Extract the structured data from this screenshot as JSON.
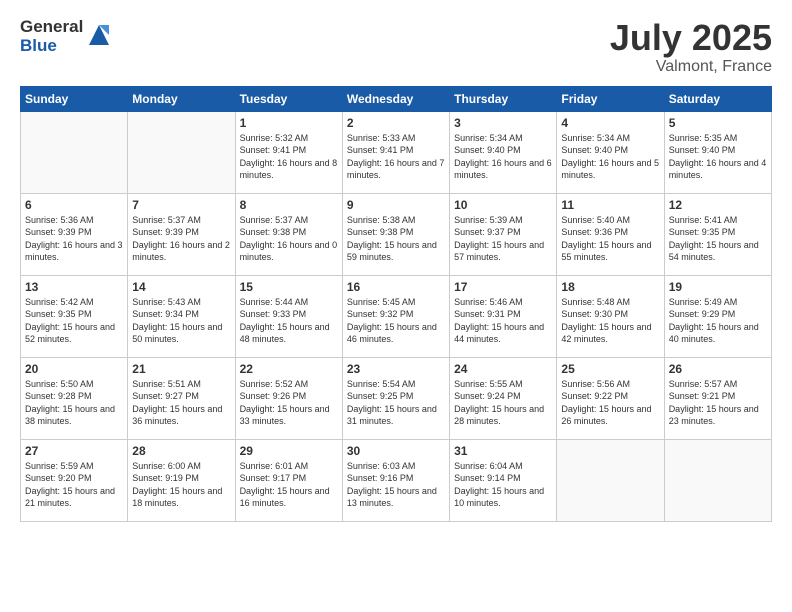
{
  "logo": {
    "general": "General",
    "blue": "Blue"
  },
  "title": "July 2025",
  "location": "Valmont, France",
  "days_of_week": [
    "Sunday",
    "Monday",
    "Tuesday",
    "Wednesday",
    "Thursday",
    "Friday",
    "Saturday"
  ],
  "weeks": [
    [
      {
        "day": "",
        "info": ""
      },
      {
        "day": "",
        "info": ""
      },
      {
        "day": "1",
        "info": "Sunrise: 5:32 AM\nSunset: 9:41 PM\nDaylight: 16 hours and 8 minutes."
      },
      {
        "day": "2",
        "info": "Sunrise: 5:33 AM\nSunset: 9:41 PM\nDaylight: 16 hours and 7 minutes."
      },
      {
        "day": "3",
        "info": "Sunrise: 5:34 AM\nSunset: 9:40 PM\nDaylight: 16 hours and 6 minutes."
      },
      {
        "day": "4",
        "info": "Sunrise: 5:34 AM\nSunset: 9:40 PM\nDaylight: 16 hours and 5 minutes."
      },
      {
        "day": "5",
        "info": "Sunrise: 5:35 AM\nSunset: 9:40 PM\nDaylight: 16 hours and 4 minutes."
      }
    ],
    [
      {
        "day": "6",
        "info": "Sunrise: 5:36 AM\nSunset: 9:39 PM\nDaylight: 16 hours and 3 minutes."
      },
      {
        "day": "7",
        "info": "Sunrise: 5:37 AM\nSunset: 9:39 PM\nDaylight: 16 hours and 2 minutes."
      },
      {
        "day": "8",
        "info": "Sunrise: 5:37 AM\nSunset: 9:38 PM\nDaylight: 16 hours and 0 minutes."
      },
      {
        "day": "9",
        "info": "Sunrise: 5:38 AM\nSunset: 9:38 PM\nDaylight: 15 hours and 59 minutes."
      },
      {
        "day": "10",
        "info": "Sunrise: 5:39 AM\nSunset: 9:37 PM\nDaylight: 15 hours and 57 minutes."
      },
      {
        "day": "11",
        "info": "Sunrise: 5:40 AM\nSunset: 9:36 PM\nDaylight: 15 hours and 55 minutes."
      },
      {
        "day": "12",
        "info": "Sunrise: 5:41 AM\nSunset: 9:35 PM\nDaylight: 15 hours and 54 minutes."
      }
    ],
    [
      {
        "day": "13",
        "info": "Sunrise: 5:42 AM\nSunset: 9:35 PM\nDaylight: 15 hours and 52 minutes."
      },
      {
        "day": "14",
        "info": "Sunrise: 5:43 AM\nSunset: 9:34 PM\nDaylight: 15 hours and 50 minutes."
      },
      {
        "day": "15",
        "info": "Sunrise: 5:44 AM\nSunset: 9:33 PM\nDaylight: 15 hours and 48 minutes."
      },
      {
        "day": "16",
        "info": "Sunrise: 5:45 AM\nSunset: 9:32 PM\nDaylight: 15 hours and 46 minutes."
      },
      {
        "day": "17",
        "info": "Sunrise: 5:46 AM\nSunset: 9:31 PM\nDaylight: 15 hours and 44 minutes."
      },
      {
        "day": "18",
        "info": "Sunrise: 5:48 AM\nSunset: 9:30 PM\nDaylight: 15 hours and 42 minutes."
      },
      {
        "day": "19",
        "info": "Sunrise: 5:49 AM\nSunset: 9:29 PM\nDaylight: 15 hours and 40 minutes."
      }
    ],
    [
      {
        "day": "20",
        "info": "Sunrise: 5:50 AM\nSunset: 9:28 PM\nDaylight: 15 hours and 38 minutes."
      },
      {
        "day": "21",
        "info": "Sunrise: 5:51 AM\nSunset: 9:27 PM\nDaylight: 15 hours and 36 minutes."
      },
      {
        "day": "22",
        "info": "Sunrise: 5:52 AM\nSunset: 9:26 PM\nDaylight: 15 hours and 33 minutes."
      },
      {
        "day": "23",
        "info": "Sunrise: 5:54 AM\nSunset: 9:25 PM\nDaylight: 15 hours and 31 minutes."
      },
      {
        "day": "24",
        "info": "Sunrise: 5:55 AM\nSunset: 9:24 PM\nDaylight: 15 hours and 28 minutes."
      },
      {
        "day": "25",
        "info": "Sunrise: 5:56 AM\nSunset: 9:22 PM\nDaylight: 15 hours and 26 minutes."
      },
      {
        "day": "26",
        "info": "Sunrise: 5:57 AM\nSunset: 9:21 PM\nDaylight: 15 hours and 23 minutes."
      }
    ],
    [
      {
        "day": "27",
        "info": "Sunrise: 5:59 AM\nSunset: 9:20 PM\nDaylight: 15 hours and 21 minutes."
      },
      {
        "day": "28",
        "info": "Sunrise: 6:00 AM\nSunset: 9:19 PM\nDaylight: 15 hours and 18 minutes."
      },
      {
        "day": "29",
        "info": "Sunrise: 6:01 AM\nSunset: 9:17 PM\nDaylight: 15 hours and 16 minutes."
      },
      {
        "day": "30",
        "info": "Sunrise: 6:03 AM\nSunset: 9:16 PM\nDaylight: 15 hours and 13 minutes."
      },
      {
        "day": "31",
        "info": "Sunrise: 6:04 AM\nSunset: 9:14 PM\nDaylight: 15 hours and 10 minutes."
      },
      {
        "day": "",
        "info": ""
      },
      {
        "day": "",
        "info": ""
      }
    ]
  ]
}
